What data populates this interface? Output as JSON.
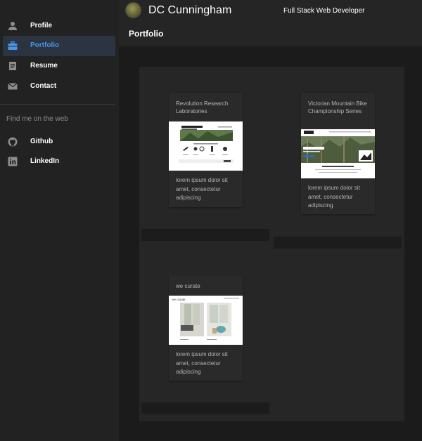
{
  "header": {
    "name": "DC Cunningham",
    "role": "Full Stack Web Developer",
    "page_title": "Portfolio"
  },
  "sidebar": {
    "items": [
      {
        "label": "Profile",
        "icon": "person-icon",
        "active": false
      },
      {
        "label": "Portfolio",
        "icon": "briefcase-icon",
        "active": true
      },
      {
        "label": "Resume",
        "icon": "document-icon",
        "active": false
      },
      {
        "label": "Contact",
        "icon": "mail-icon",
        "active": false
      }
    ],
    "subheader": "Find me on the web",
    "social": [
      {
        "label": "Github",
        "icon": "github-icon"
      },
      {
        "label": "LinkedIn",
        "icon": "linkedin-icon"
      }
    ]
  },
  "portfolio": [
    {
      "title": "Revolution Research Laboratories",
      "description": "lorem ipsum dolor sit amet, consectetur adipiscing"
    },
    {
      "title": "Victorian Mountain Bike Championship Series",
      "description": "lorem ipsum dolor sit amet, consectetur adipiscing"
    },
    {
      "title": "we curate",
      "description": "lorem ipsum dolor sit amet, consectetur adipiscing"
    }
  ],
  "colors": {
    "accent": "#4a95e6",
    "sidebar_bg": "#222222",
    "active_bg": "#2b3440"
  }
}
